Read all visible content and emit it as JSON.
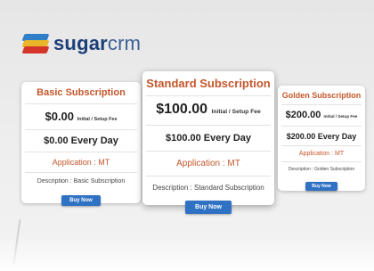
{
  "brand": {
    "name_bold": "sugar",
    "name_light": "crm"
  },
  "colors": {
    "accent": "#c5562b",
    "button": "#2f71c3",
    "brand_text": "#1c3f78"
  },
  "plans": [
    {
      "title": "Basic Subscription",
      "price": "$0.00",
      "price_note": "Initial / Setup Fee",
      "daily": "$0.00 Every Day",
      "application": "Application : MT",
      "description": "Description : Basic Subscription",
      "button": "Buy Now"
    },
    {
      "title": "Standard Subscription",
      "price": "$100.00",
      "price_note": "Initial / Setup Fee",
      "daily": "$100.00 Every Day",
      "application": "Application : MT",
      "description": "Description : Standard Subscription",
      "button": "Buy Now"
    },
    {
      "title": "Golden Subscription",
      "price": "$200.00",
      "price_note": "Initial / Setup Fee",
      "daily": "$200.00 Every Day",
      "application": "Application : MT",
      "description": "Description : Golden Subscription",
      "button": "Buy Now"
    }
  ]
}
